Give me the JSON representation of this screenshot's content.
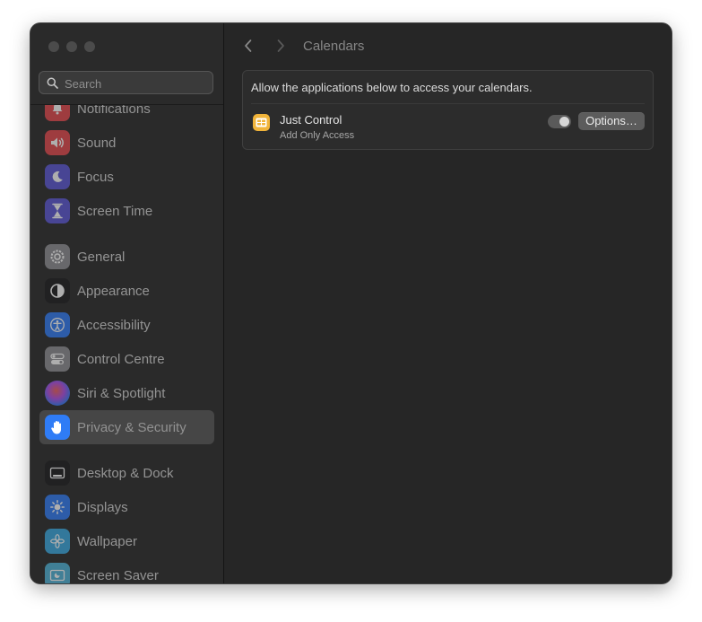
{
  "sidebar": {
    "search": {
      "placeholder": "Search"
    },
    "items": [
      {
        "label": "Notifications",
        "icon": "bell-icon",
        "color": "#e5484d"
      },
      {
        "label": "Sound",
        "icon": "speaker-icon",
        "color": "#e5484d"
      },
      {
        "label": "Focus",
        "icon": "moon-icon",
        "color": "#5b57d6"
      },
      {
        "label": "Screen Time",
        "icon": "hourglass-icon",
        "color": "#5b57d6"
      },
      {
        "label": "General",
        "icon": "gear-icon",
        "color": "#8e8e93"
      },
      {
        "label": "Appearance",
        "icon": "appearance-icon",
        "color": "#1c1c1e"
      },
      {
        "label": "Accessibility",
        "icon": "accessibility-icon",
        "color": "#2f7cf6"
      },
      {
        "label": "Control Centre",
        "icon": "control-centre-icon",
        "color": "#8e8e93"
      },
      {
        "label": "Siri & Spotlight",
        "icon": "siri-icon",
        "color": "#9b4de0"
      },
      {
        "label": "Privacy & Security",
        "icon": "hand-icon",
        "color": "#2f7cf6"
      },
      {
        "label": "Desktop & Dock",
        "icon": "dock-icon",
        "color": "#1c1c1e"
      },
      {
        "label": "Displays",
        "icon": "sun-icon",
        "color": "#2f7cf6"
      },
      {
        "label": "Wallpaper",
        "icon": "flower-icon",
        "color": "#39a9e0"
      },
      {
        "label": "Screen Saver",
        "icon": "screen-saver-icon",
        "color": "#4fb3d9"
      }
    ],
    "selected": "Privacy & Security"
  },
  "main": {
    "title": "Calendars",
    "description": "Allow the applications below to access your calendars.",
    "apps": [
      {
        "name": "Just Control",
        "access": "Add Only Access",
        "enabled": true,
        "options_label": "Options…",
        "icon": "just-control-icon",
        "icon_color": "#f1b43a"
      }
    ]
  },
  "colors": {
    "accent": "#2f7cf6",
    "window_bg": "#262626",
    "sidebar_bg": "#2a2a2a"
  }
}
